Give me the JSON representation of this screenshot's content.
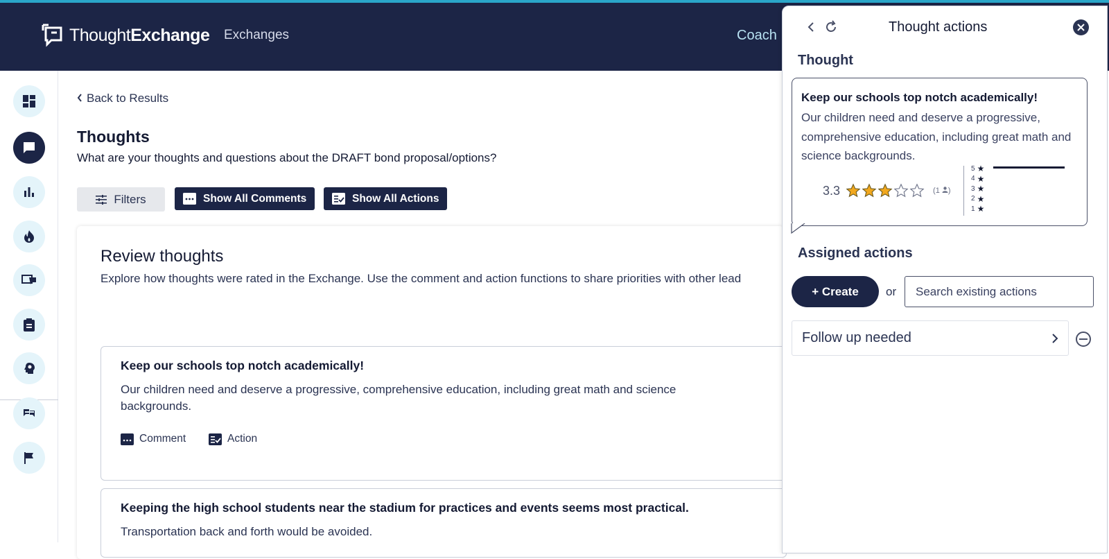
{
  "header": {
    "logo_prefix": "Thought",
    "logo_suffix": "Exchange",
    "nav_exchanges": "Exchanges",
    "nav_coach": "Coach"
  },
  "sidebar": {
    "items": [
      {
        "icon": "dashboard-icon"
      },
      {
        "icon": "chat-bubble-icon",
        "active": true
      },
      {
        "icon": "bar-chart-icon"
      },
      {
        "icon": "flame-icon"
      },
      {
        "icon": "presentation-chat-icon"
      },
      {
        "icon": "clipboard-icon"
      },
      {
        "icon": "lightbulb-head-icon"
      },
      {
        "icon": "comments-icon"
      },
      {
        "icon": "flag-icon"
      }
    ]
  },
  "main": {
    "back_label": "Back to Results",
    "title": "Thoughts",
    "subtitle": "What are your thoughts and questions about the DRAFT bond proposal/options?",
    "filters_label": "Filters",
    "show_comments_label": "Show All Comments",
    "show_actions_label": "Show All Actions",
    "review": {
      "title": "Review thoughts",
      "description": "Explore how thoughts were rated in the Exchange. Use the comment and action functions to share priorities with other lead"
    },
    "thoughts": [
      {
        "title": "Keep our schools top notch academically!",
        "body": "Our children need and deserve a progressive, comprehensive education, including great math and science backgrounds.",
        "comment_label": "Comment",
        "action_label": "Action"
      },
      {
        "title": "Keeping the high school students near the stadium for practices and events seems most practical.",
        "body": "Transportation back and forth would be avoided."
      }
    ]
  },
  "panel": {
    "title": "Thought actions",
    "thought_heading": "Thought",
    "thought": {
      "title": "Keep our schools top notch academically!",
      "body": "Our children need and deserve a progressive, comprehensive education, including great math and science backgrounds.",
      "rating": "3.3",
      "stars_filled": 3,
      "stars_total": 5,
      "raters": "1",
      "distribution": [
        {
          "label": "5",
          "share": 1.0
        },
        {
          "label": "4",
          "share": 0
        },
        {
          "label": "3",
          "share": 0
        },
        {
          "label": "2",
          "share": 0
        },
        {
          "label": "1",
          "share": 0
        }
      ]
    },
    "assigned_heading": "Assigned actions",
    "create_label": "+ Create",
    "or_label": "or",
    "search_placeholder": "Search existing actions",
    "actions": [
      {
        "label": "Follow up needed"
      }
    ]
  },
  "colors": {
    "navy": "#1c2546",
    "accent_strip": "#2aa6c9",
    "star": "#f2a81d",
    "sidebar_circle": "#e4f4fa"
  }
}
